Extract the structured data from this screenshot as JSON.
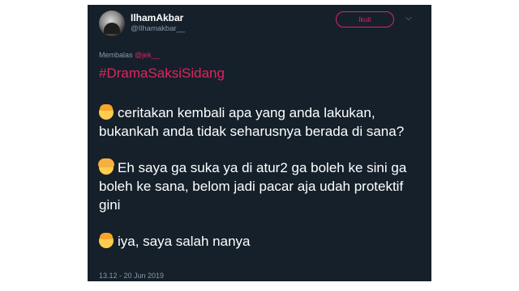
{
  "header": {
    "display_name": "IlhamAkbar",
    "handle": "@Ilhamakbar__",
    "follow_label": "Ikuti",
    "chevron_icon": "chevron-down-icon"
  },
  "reply": {
    "prefix": "Membalas",
    "mention": "@jek__"
  },
  "tweet": {
    "hashtag": "#DramaSaksiSidang",
    "lines": [
      {
        "icon": "man-emoji-icon",
        "text": "ceritakan kembali apa yang anda lakukan, bukankah anda tidak seharusnya berada di sana?"
      },
      {
        "icon": "girl-emoji-icon",
        "text": "Eh saya ga suka ya di atur2 ga boleh ke sini ga boleh ke sana, belom jadi pacar aja udah protektif gini"
      },
      {
        "icon": "man-emoji-icon",
        "text": "iya, saya salah nanya"
      }
    ],
    "timestamp": "13.12 - 20 Jun 2019"
  },
  "colors": {
    "background": "#15202b",
    "accent": "#e0245e",
    "secondary_text": "#8899a6"
  }
}
